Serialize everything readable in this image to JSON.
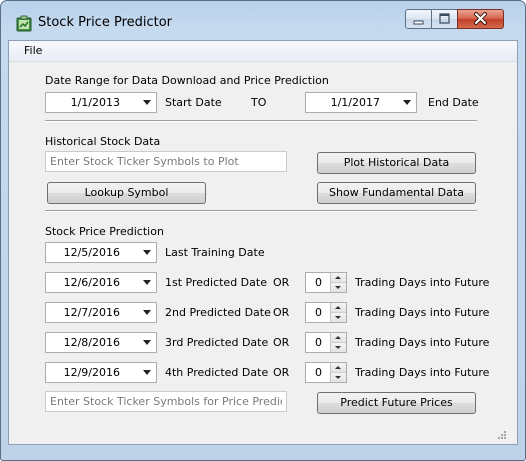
{
  "window": {
    "title": "Stock Price Predictor",
    "icon": "app-icon",
    "controls": [
      "minimize-icon",
      "maximize-icon",
      "close-icon"
    ]
  },
  "menu": {
    "file": "File"
  },
  "date_range": {
    "section_label": "Date Range for Data Download and Price Prediction",
    "start_value": "1/1/2013",
    "start_label": "Start Date",
    "to_label": "TO",
    "end_value": "1/1/2017",
    "end_label": "End Date"
  },
  "historical": {
    "section_label": "Historical Stock Data",
    "ticker_placeholder": "Enter Stock Ticker Symbols to Plot",
    "plot_button": "Plot Historical Data",
    "lookup_button": "Lookup Symbol",
    "fundamental_button": "Show Fundamental Data"
  },
  "prediction": {
    "section_label": "Stock Price Prediction",
    "training_date": "12/5/2016",
    "training_label": "Last Training Date",
    "rows": [
      {
        "date": "12/6/2016",
        "label": "1st Predicted Date",
        "or": "OR",
        "days": "0",
        "days_label": "Trading Days into Future"
      },
      {
        "date": "12/7/2016",
        "label": "2nd Predicted Date",
        "or": "OR",
        "days": "0",
        "days_label": "Trading Days into Future"
      },
      {
        "date": "12/8/2016",
        "label": "3rd Predicted Date",
        "or": "OR",
        "days": "0",
        "days_label": "Trading Days into Future"
      },
      {
        "date": "12/9/2016",
        "label": "4th Predicted Date",
        "or": "OR",
        "days": "0",
        "days_label": "Trading Days into Future"
      }
    ],
    "ticker_placeholder": "Enter Stock Ticker Symbols for Price Prediction",
    "predict_button": "Predict Future Prices"
  }
}
